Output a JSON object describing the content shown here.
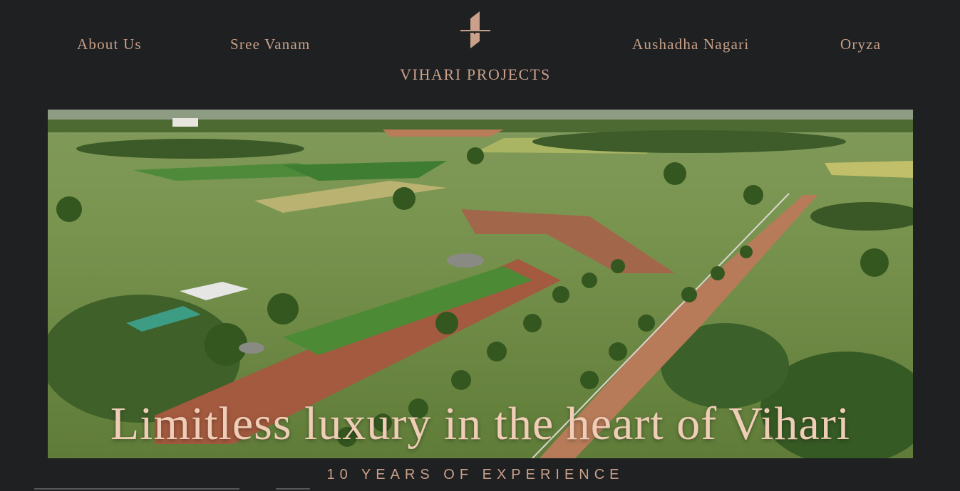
{
  "nav": {
    "about": "About Us",
    "sree_vanam": "Sree Vanam",
    "aushadha_nagari": "Aushadha Nagari",
    "oryza": "Oryza"
  },
  "brand": {
    "name": "VIHARI PROJECTS",
    "logo_icon": "vihari-logo-icon"
  },
  "hero": {
    "title": "Limitless luxury in the heart of Vihari",
    "image": "aerial-farmland-image"
  },
  "tagline": "10 YEARS OF EXPERIENCE",
  "colors": {
    "background": "#1e2022",
    "accent": "#c9a089",
    "hero_text": "#f0cdb6"
  }
}
